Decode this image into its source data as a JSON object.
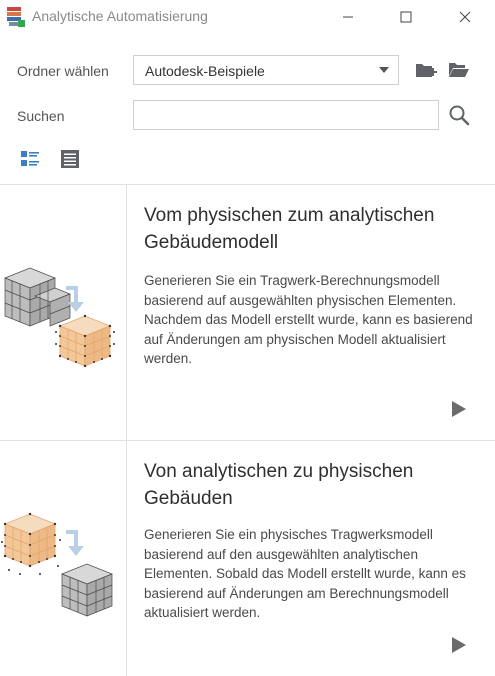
{
  "window": {
    "title": "Analytische Automatisierung"
  },
  "controls": {
    "folder_label": "Ordner wählen",
    "folder_value": "Autodesk-Beispiele",
    "search_label": "Suchen",
    "search_value": "",
    "search_placeholder": ""
  },
  "cards": [
    {
      "title": "Vom physischen zum analytischen Gebäudemodell",
      "description": "Generieren Sie ein Tragwerk-Berechnungsmodell basierend auf ausgewählten physischen Elementen. Nachdem das Modell erstellt wurde, kann es basierend auf Änderungen am physischen Modell aktualisiert werden."
    },
    {
      "title": "Von analytischen zu physischen Gebäuden",
      "description": "Generieren Sie ein physisches Tragwerksmodell basierend auf den ausgewählten analytischen Elementen. Sobald das Modell erstellt wurde, kann es basierend auf Änderungen am Berechnungsmodell aktualisiert werden."
    }
  ],
  "colors": {
    "accent_blue": "#3a7fc1",
    "analytic_orange": "#f2c79a",
    "icon_gray": "#5f6368"
  }
}
